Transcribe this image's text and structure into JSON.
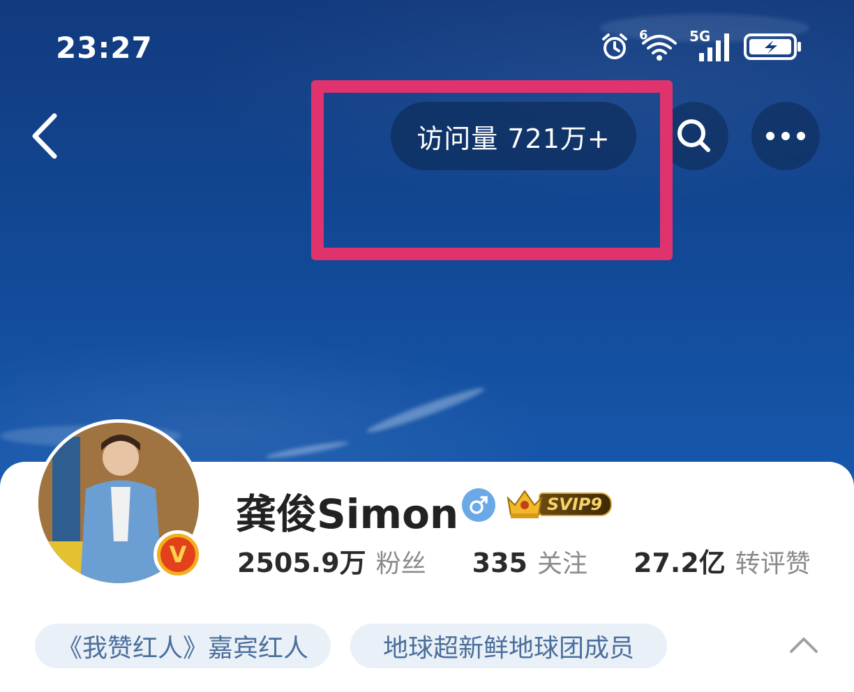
{
  "status_bar": {
    "time": "23:27",
    "icons": [
      "alarm-icon",
      "wifi-icon",
      "5g-signal-icon",
      "battery-charging-icon"
    ],
    "wifi_superscript": "6",
    "network_label": "5G"
  },
  "header": {
    "visits_text": "访问量 721万+",
    "back_icon": "back-arrow-icon",
    "search_icon": "search-icon",
    "more_icon": "more-icon",
    "highlight_color": "#e0336e"
  },
  "profile": {
    "name": "龚俊Simon",
    "gender": "male",
    "verified_badge": "V",
    "vip_badge": "SVIP9",
    "stats": [
      {
        "value": "2505.9万",
        "label": "粉丝"
      },
      {
        "value": "335",
        "label": "关注"
      },
      {
        "value": "27.2亿",
        "label": "转评赞"
      }
    ],
    "tags": [
      "《我赞红人》嘉宾红人",
      "地球超新鲜地球团成员"
    ]
  }
}
